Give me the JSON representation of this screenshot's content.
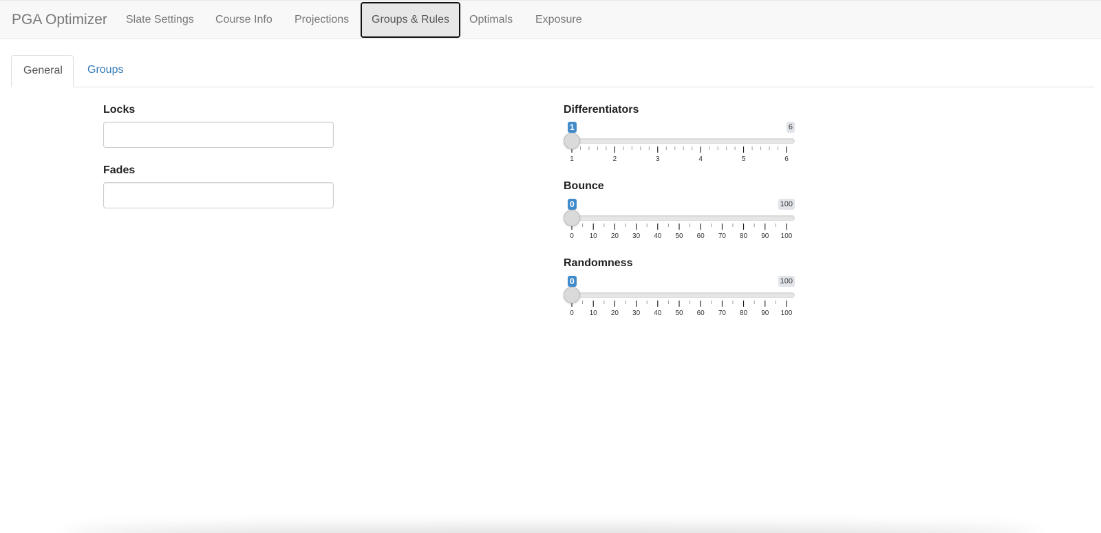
{
  "navbar": {
    "brand": "PGA Optimizer",
    "items": [
      {
        "label": "Slate Settings"
      },
      {
        "label": "Course Info"
      },
      {
        "label": "Projections"
      },
      {
        "label": "Groups & Rules",
        "active": true
      },
      {
        "label": "Optimals"
      },
      {
        "label": "Exposure"
      }
    ]
  },
  "tabs": [
    {
      "label": "General",
      "active": true
    },
    {
      "label": "Groups"
    }
  ],
  "form": {
    "locks": {
      "label": "Locks",
      "value": ""
    },
    "fades": {
      "label": "Fades",
      "value": ""
    }
  },
  "sliders": [
    {
      "label": "Differentiators",
      "min": 1,
      "max": 6,
      "value": 1,
      "min_label": "1",
      "max_label": "6",
      "major_ticks": [
        "1",
        "2",
        "3",
        "4",
        "5",
        "6"
      ],
      "minor_per_major": 4
    },
    {
      "label": "Bounce",
      "min": 0,
      "max": 100,
      "value": 0,
      "min_label": "0",
      "max_label": "100",
      "major_ticks": [
        "0",
        "10",
        "20",
        "30",
        "40",
        "50",
        "60",
        "70",
        "80",
        "90",
        "100"
      ],
      "minor_per_major": 1
    },
    {
      "label": "Randomness",
      "min": 0,
      "max": 100,
      "value": 0,
      "min_label": "0",
      "max_label": "100",
      "major_ticks": [
        "0",
        "10",
        "20",
        "30",
        "40",
        "50",
        "60",
        "70",
        "80",
        "90",
        "100"
      ],
      "minor_per_major": 1
    }
  ],
  "colors": {
    "accent": "#428bca",
    "link": "#337ab7",
    "navbar_bg": "#f8f8f8"
  }
}
